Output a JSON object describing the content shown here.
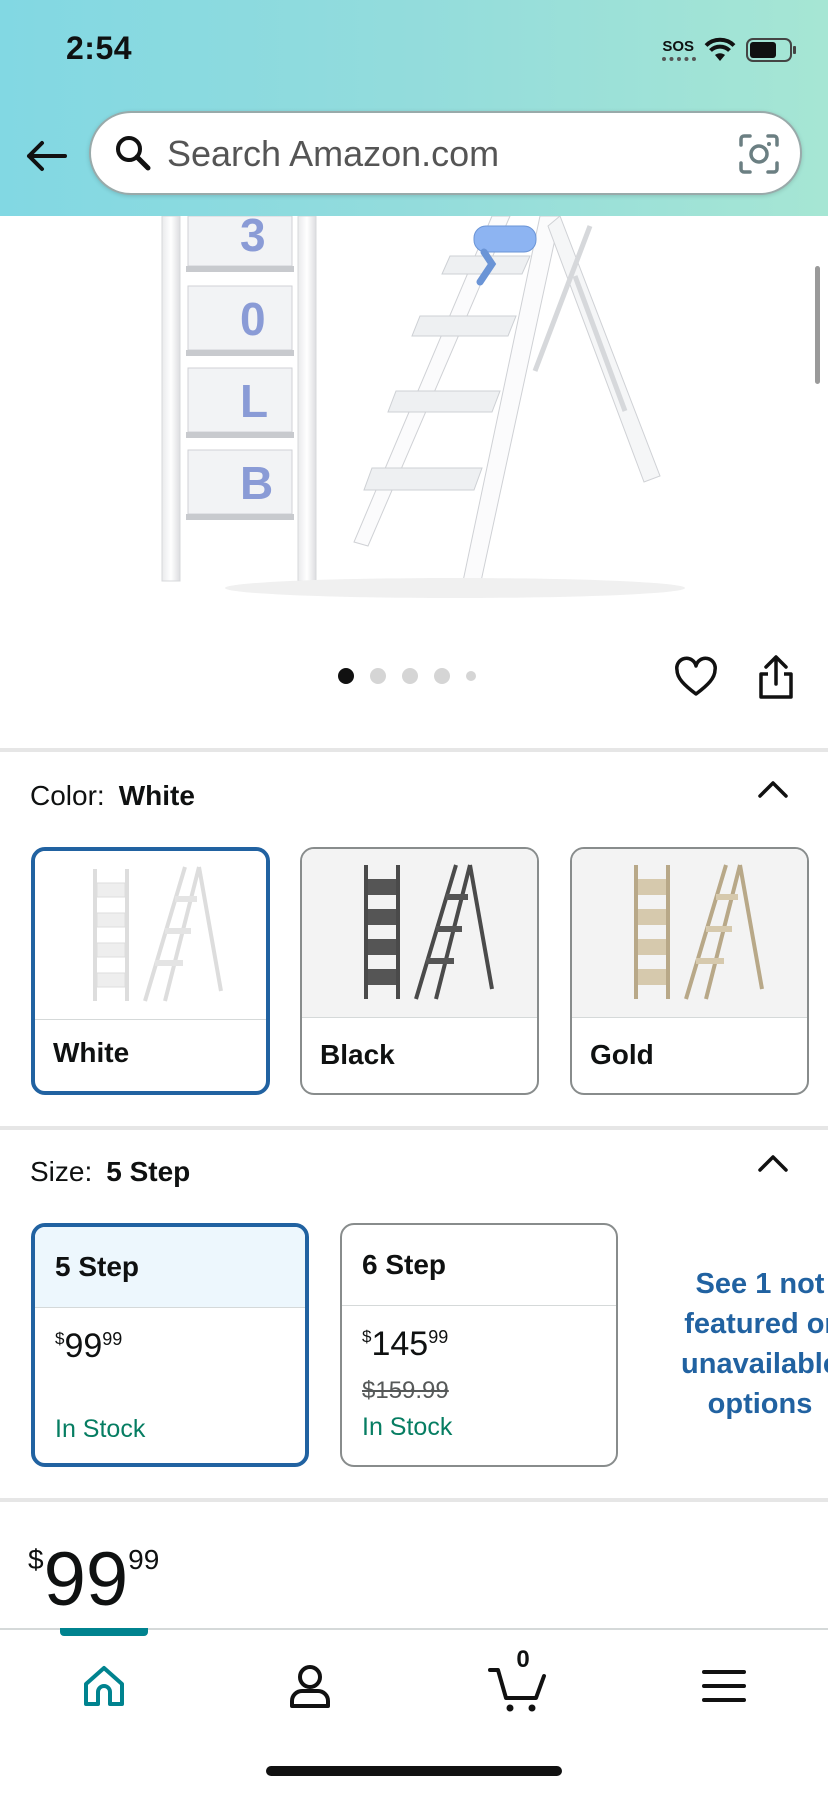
{
  "status_bar": {
    "time": "2:54",
    "sos": "SOS"
  },
  "search": {
    "placeholder": "Search Amazon.com"
  },
  "hero": {
    "ladder_lettering": [
      "3",
      "0",
      "L",
      "B"
    ]
  },
  "carousel": {
    "total_images": 5,
    "active_index": 0
  },
  "color": {
    "label": "Color:",
    "selected": "White",
    "options": [
      {
        "name": "White",
        "selected": true,
        "swatch_color": "#ffffff"
      },
      {
        "name": "Black",
        "selected": false,
        "swatch_color": "#4a4a4a"
      },
      {
        "name": "Gold",
        "selected": false,
        "swatch_color": "#c9b99a"
      }
    ]
  },
  "size": {
    "label": "Size:",
    "selected": "5 Step",
    "options": [
      {
        "name": "5 Step",
        "currency": "$",
        "price_whole": "99",
        "price_cents": "99",
        "list_price": "",
        "availability": "In Stock",
        "selected": true
      },
      {
        "name": "6 Step",
        "currency": "$",
        "price_whole": "145",
        "price_cents": "99",
        "list_price": "$159.99",
        "availability": "In Stock",
        "selected": false
      }
    ],
    "see_more": "See 1 not featured or unavailable options"
  },
  "price": {
    "currency": "$",
    "whole": "99",
    "cents": "99"
  },
  "bottom_nav": {
    "items": [
      "home-icon",
      "account-icon",
      "cart-icon",
      "menu-icon"
    ],
    "active": "home",
    "cart_count": "0"
  },
  "colors": {
    "accent_blue": "#2162a1",
    "in_stock_green": "#067d62",
    "nav_teal": "#00838f"
  }
}
